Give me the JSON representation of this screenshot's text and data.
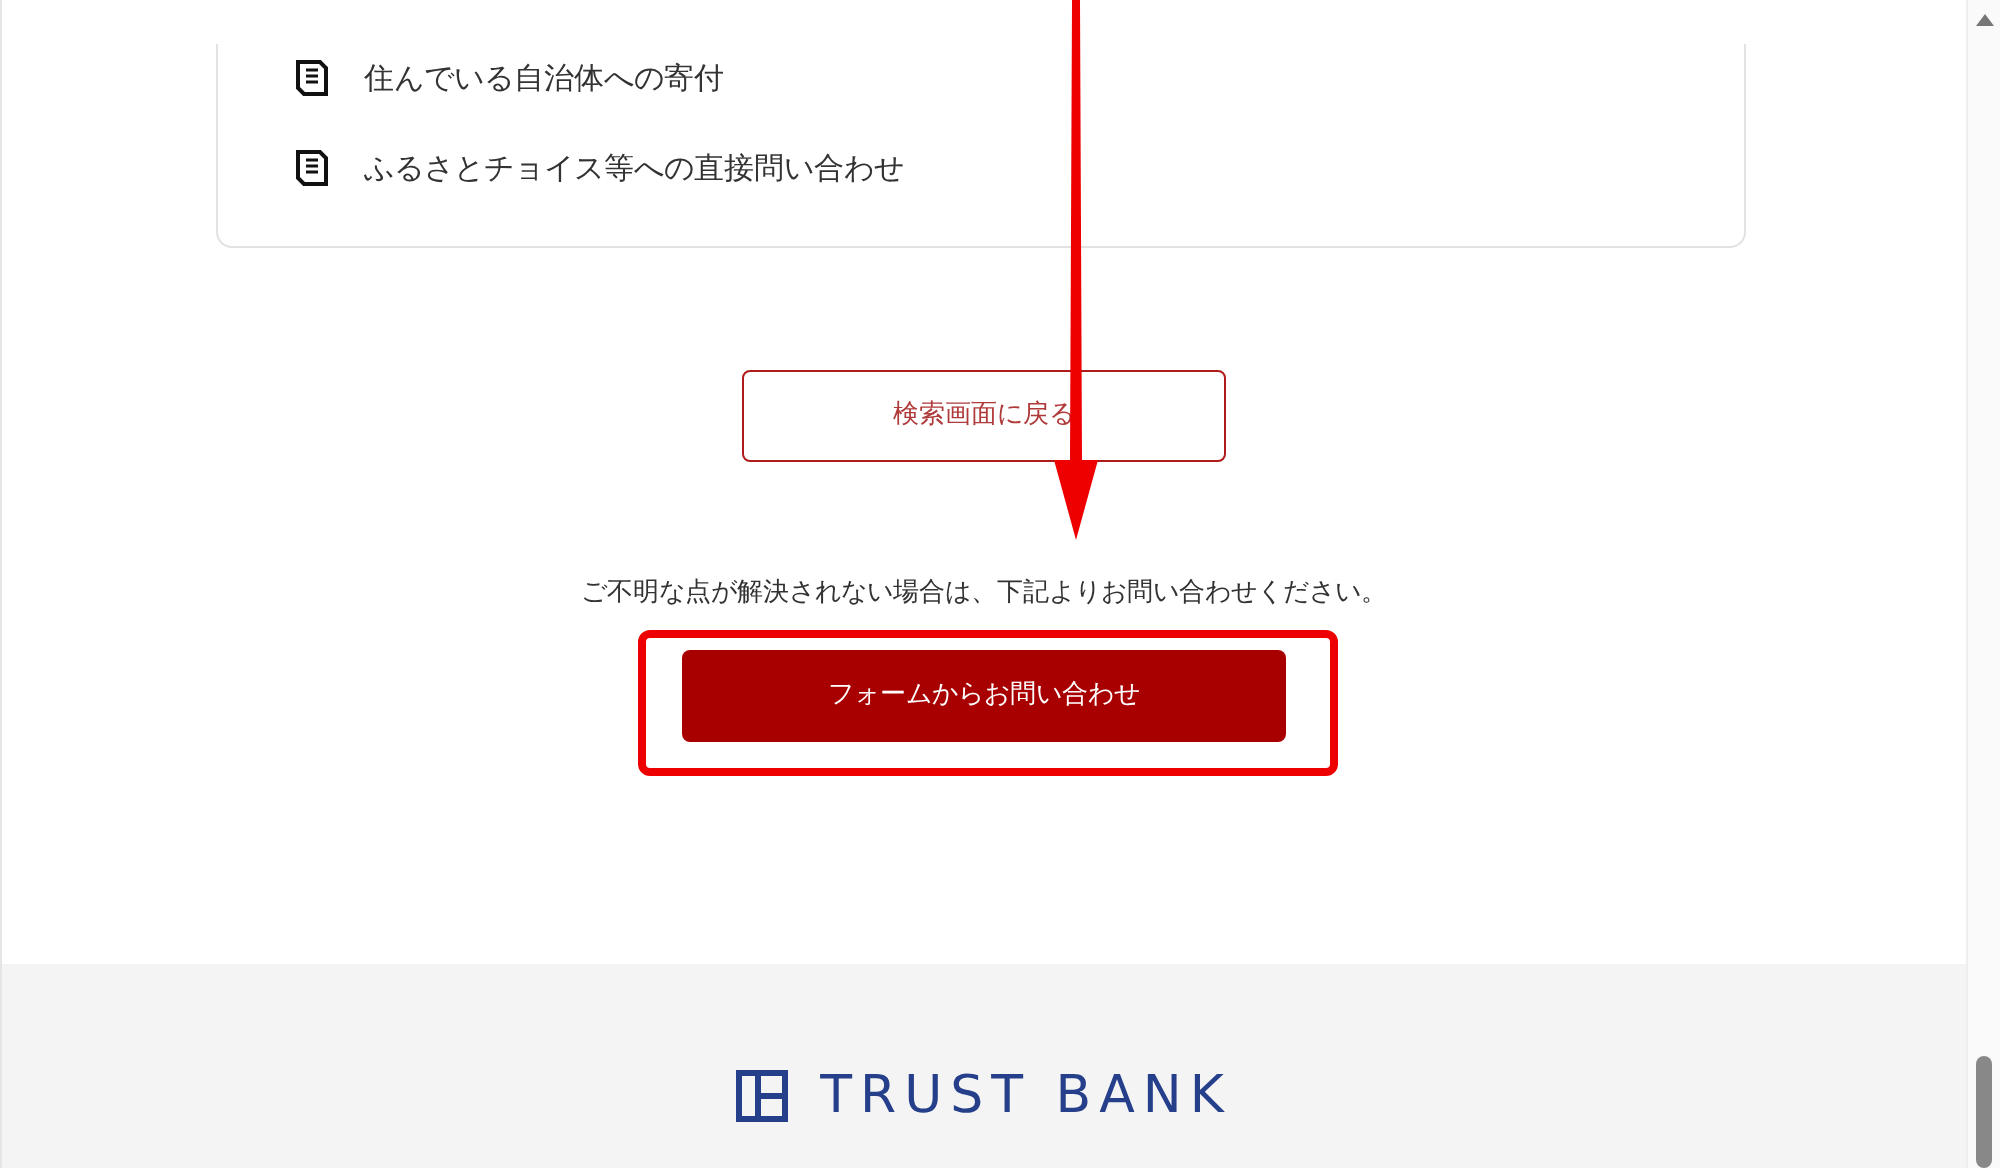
{
  "card": {
    "items": [
      "住んでいる自治体への寄付",
      "ふるさとチョイス等への直接問い合わせ"
    ]
  },
  "back_button": "検索画面に戻る",
  "notice": "ご不明な点が解決されない場合は、下記よりお問い合わせください。",
  "contact_button": "フォームからお問い合わせ",
  "footer": {
    "logo": "TRUST BANK"
  }
}
